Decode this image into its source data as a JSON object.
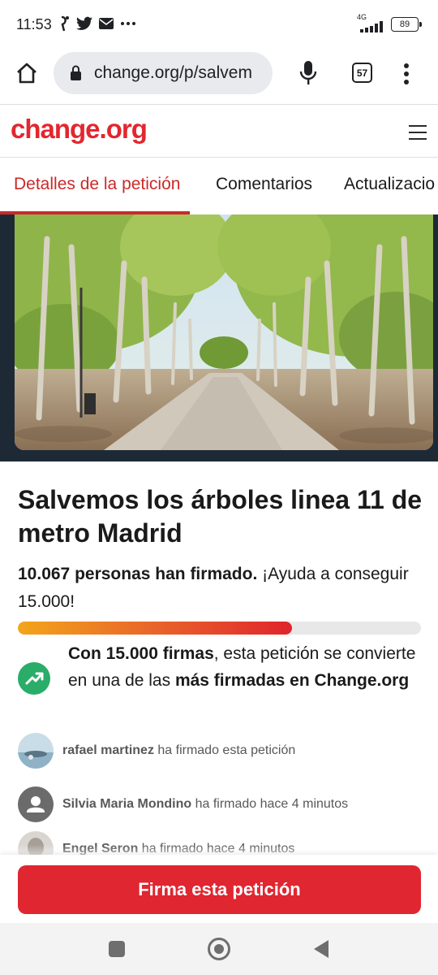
{
  "status_bar": {
    "time": "11:53",
    "battery": "89",
    "network": "4G"
  },
  "browser": {
    "url": "change.org/p/salvem",
    "tab_count": "57"
  },
  "site": {
    "logo": "change.org"
  },
  "tabs": [
    {
      "label": "Detalles de la petición"
    },
    {
      "label": "Comentarios"
    },
    {
      "label": "Actualizacio"
    }
  ],
  "petition": {
    "title": "Salvemos los árboles linea 11 de metro Madrid",
    "signed_bold": "10.067 personas han firmado.",
    "signed_rest": " ¡Ayuda a conseguir 15.000!",
    "progress_fraction": 0.68,
    "milestone_bold1": "Con 15.000 firmas",
    "milestone_text1": ", esta petición se convierte en una de las ",
    "milestone_bold2": "más firmadas en Change.org"
  },
  "signers": [
    {
      "name": "rafael martinez",
      "action": " ha firmado esta petición"
    },
    {
      "name": "Silvia Maria Mondino",
      "action": " ha firmado hace 4 minutos"
    },
    {
      "name": "Engel Seron",
      "action": " ha firmado hace 4 minutos"
    }
  ],
  "cta": {
    "label": "Firma esta petición"
  },
  "colors": {
    "brand": "#e3262f",
    "success": "#29ad69"
  }
}
